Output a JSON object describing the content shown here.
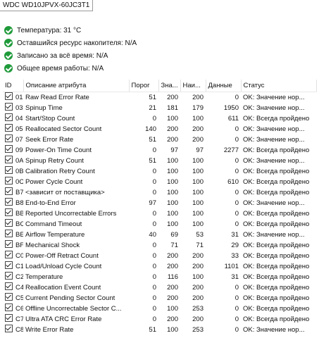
{
  "drive": {
    "name": "WDC WD10JPVX-60JC3T1"
  },
  "summary": [
    {
      "label": "Температура: 31 °C"
    },
    {
      "label": "Оставшийся ресурс накопителя: N/A"
    },
    {
      "label": "Записано за всё время: N/A"
    },
    {
      "label": "Общее время работы: N/A"
    }
  ],
  "columns": {
    "id": "ID",
    "description": "Описание атрибута",
    "threshold": "Порог",
    "value": "Зна...",
    "worst": "Наи...",
    "raw": "Данные",
    "status": "Статус"
  },
  "rows": [
    {
      "id": "01",
      "desc": "Raw Read Error Rate",
      "threshold": "51",
      "value": "200",
      "worst": "200",
      "raw": "0",
      "status": "OK: Значение нор..."
    },
    {
      "id": "03",
      "desc": "Spinup Time",
      "threshold": "21",
      "value": "181",
      "worst": "179",
      "raw": "1950",
      "status": "OK: Значение нор..."
    },
    {
      "id": "04",
      "desc": "Start/Stop Count",
      "threshold": "0",
      "value": "100",
      "worst": "100",
      "raw": "611",
      "status": "OK: Всегда пройдено"
    },
    {
      "id": "05",
      "desc": "Reallocated Sector Count",
      "threshold": "140",
      "value": "200",
      "worst": "200",
      "raw": "0",
      "status": "OK: Значение нор..."
    },
    {
      "id": "07",
      "desc": "Seek Error Rate",
      "threshold": "51",
      "value": "200",
      "worst": "200",
      "raw": "0",
      "status": "OK: Значение нор..."
    },
    {
      "id": "09",
      "desc": "Power-On Time Count",
      "threshold": "0",
      "value": "97",
      "worst": "97",
      "raw": "2277",
      "status": "OK: Всегда пройдено"
    },
    {
      "id": "0A",
      "desc": "Spinup Retry Count",
      "threshold": "51",
      "value": "100",
      "worst": "100",
      "raw": "0",
      "status": "OK: Значение нор..."
    },
    {
      "id": "0B",
      "desc": "Calibration Retry Count",
      "threshold": "0",
      "value": "100",
      "worst": "100",
      "raw": "0",
      "status": "OK: Всегда пройдено"
    },
    {
      "id": "0C",
      "desc": "Power Cycle Count",
      "threshold": "0",
      "value": "100",
      "worst": "100",
      "raw": "610",
      "status": "OK: Всегда пройдено"
    },
    {
      "id": "B7",
      "desc": "<зависит от поставщика>",
      "threshold": "0",
      "value": "100",
      "worst": "100",
      "raw": "0",
      "status": "OK: Всегда пройдено"
    },
    {
      "id": "B8",
      "desc": "End-to-End Error",
      "threshold": "97",
      "value": "100",
      "worst": "100",
      "raw": "0",
      "status": "OK: Значение нор..."
    },
    {
      "id": "BB",
      "desc": "Reported Uncorrectable Errors",
      "threshold": "0",
      "value": "100",
      "worst": "100",
      "raw": "0",
      "status": "OK: Всегда пройдено"
    },
    {
      "id": "BC",
      "desc": "Command Timeout",
      "threshold": "0",
      "value": "100",
      "worst": "100",
      "raw": "0",
      "status": "OK: Всегда пройдено"
    },
    {
      "id": "BE",
      "desc": "Airflow Temperature",
      "threshold": "40",
      "value": "69",
      "worst": "53",
      "raw": "31",
      "status": "OK: Значение нор..."
    },
    {
      "id": "BF",
      "desc": "Mechanical Shock",
      "threshold": "0",
      "value": "71",
      "worst": "71",
      "raw": "29",
      "status": "OK: Всегда пройдено"
    },
    {
      "id": "C0",
      "desc": "Power-Off Retract Count",
      "threshold": "0",
      "value": "200",
      "worst": "200",
      "raw": "33",
      "status": "OK: Всегда пройдено"
    },
    {
      "id": "C1",
      "desc": "Load/Unload Cycle Count",
      "threshold": "0",
      "value": "200",
      "worst": "200",
      "raw": "1101",
      "status": "OK: Всегда пройдено"
    },
    {
      "id": "C2",
      "desc": "Temperature",
      "threshold": "0",
      "value": "116",
      "worst": "100",
      "raw": "31",
      "status": "OK: Всегда пройдено"
    },
    {
      "id": "C4",
      "desc": "Reallocation Event Count",
      "threshold": "0",
      "value": "200",
      "worst": "200",
      "raw": "0",
      "status": "OK: Всегда пройдено"
    },
    {
      "id": "C5",
      "desc": "Current Pending Sector Count",
      "threshold": "0",
      "value": "200",
      "worst": "200",
      "raw": "0",
      "status": "OK: Всегда пройдено"
    },
    {
      "id": "C6",
      "desc": "Offline Uncorrectable Sector C...",
      "threshold": "0",
      "value": "100",
      "worst": "253",
      "raw": "0",
      "status": "OK: Всегда пройдено"
    },
    {
      "id": "C7",
      "desc": "Ultra ATA CRC Error Rate",
      "threshold": "0",
      "value": "200",
      "worst": "200",
      "raw": "0",
      "status": "OK: Всегда пройдено"
    },
    {
      "id": "C8",
      "desc": "Write Error Rate",
      "threshold": "51",
      "value": "100",
      "worst": "253",
      "raw": "0",
      "status": "OK: Значение нор..."
    }
  ]
}
